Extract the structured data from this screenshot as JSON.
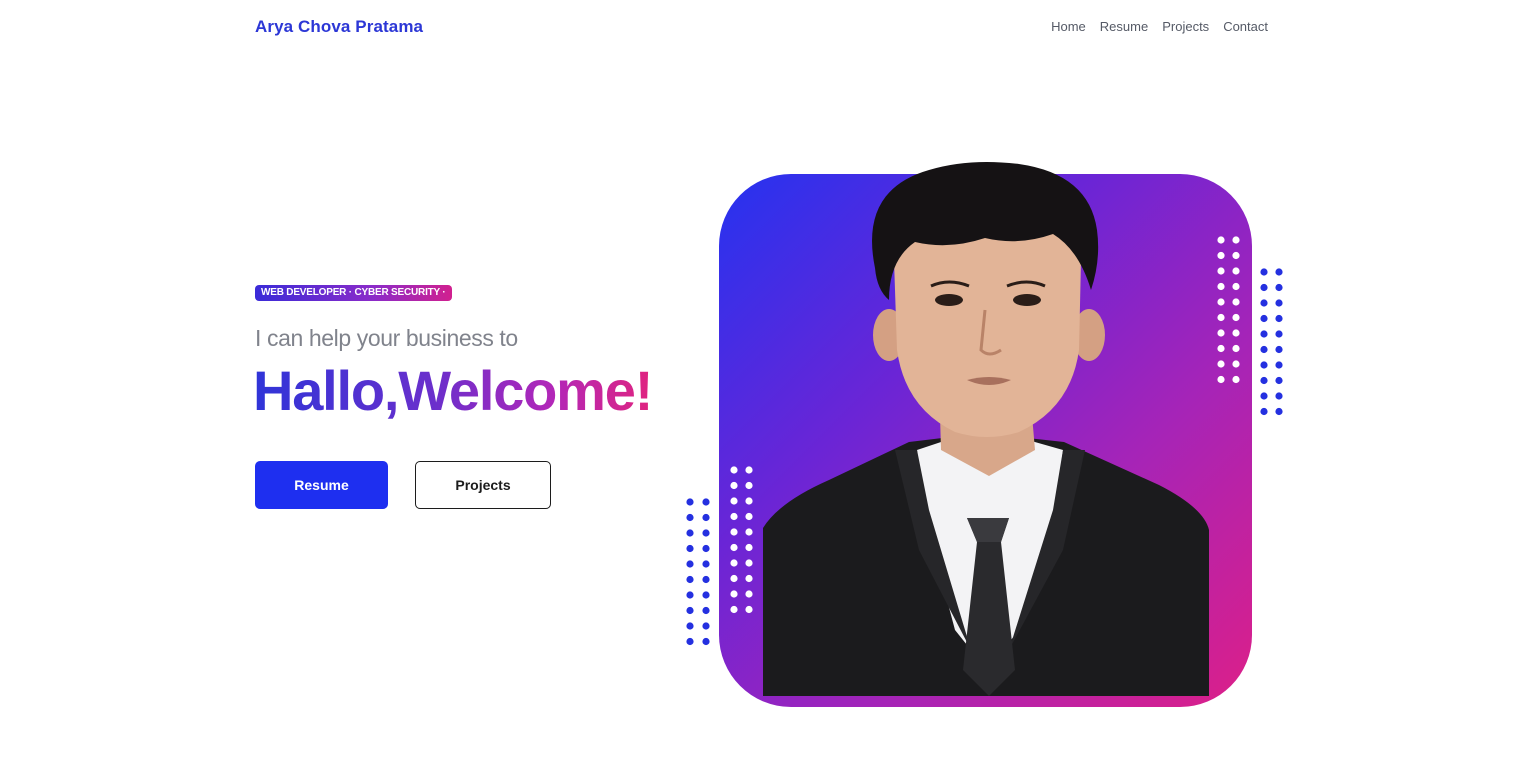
{
  "header": {
    "brand": "Arya Chova Pratama",
    "nav": [
      "Home",
      "Resume",
      "Projects",
      "Contact"
    ]
  },
  "hero": {
    "badge": "WEB DEVELOPER · CYBER SECURITY ·",
    "tagline": "I can help your business to",
    "headline": "Hallo,Welcome!",
    "buttons": {
      "primary": "Resume",
      "secondary": "Projects"
    }
  },
  "colors": {
    "brand": "#2c37d6",
    "primary_button": "#1e2ff0",
    "gradient_start": "#2533f0",
    "gradient_end": "#dd1f88"
  }
}
